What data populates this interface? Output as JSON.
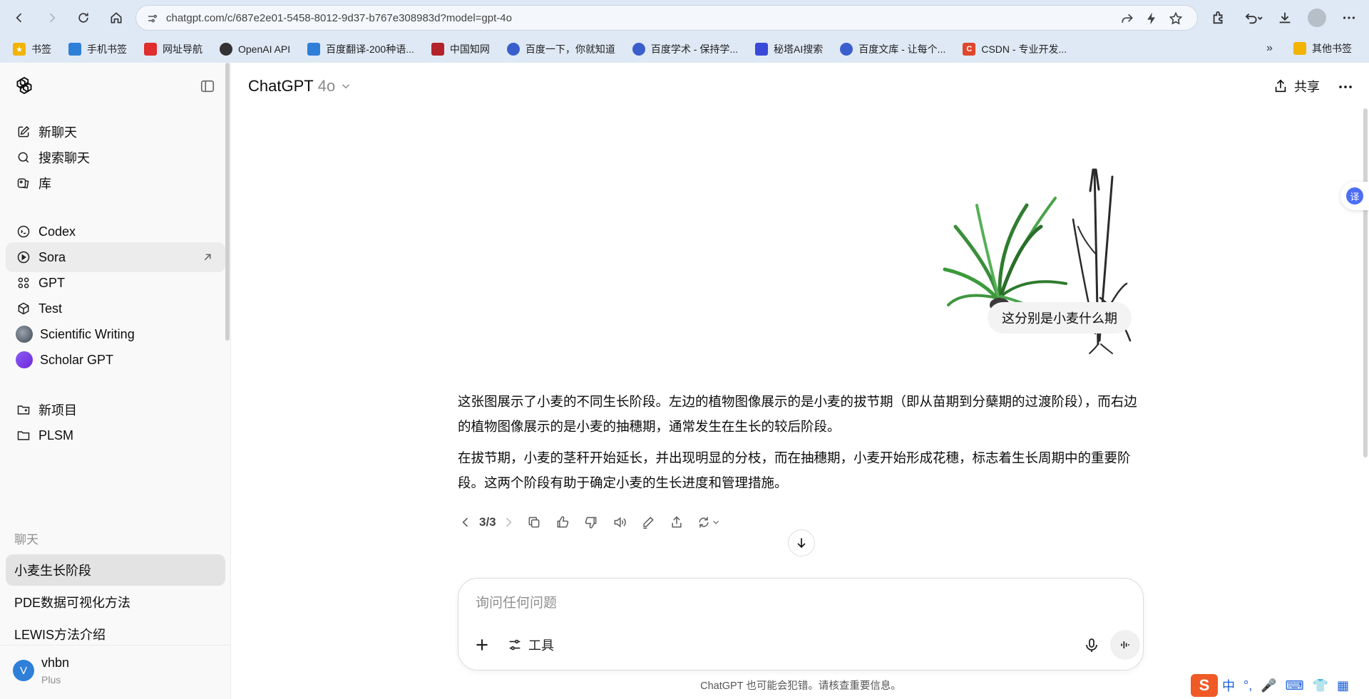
{
  "browser": {
    "url": "chatgpt.com/c/687e2e01-5458-8012-9d37-b767e308983d?model=gpt-4o",
    "bookmarks": [
      {
        "label": "书签",
        "color": "#f2b400"
      },
      {
        "label": "手机书签",
        "color": "#2f7fd9"
      },
      {
        "label": "网址导航",
        "color": "#e02d2d"
      },
      {
        "label": "OpenAI API",
        "color": "#333333"
      },
      {
        "label": "百度翻译-200种语...",
        "color": "#2f7fd9"
      },
      {
        "label": "中国知网",
        "color": "#b4232a"
      },
      {
        "label": "百度一下，你就知道",
        "color": "#3a5fcd"
      },
      {
        "label": "百度学术 - 保持学...",
        "color": "#3a5fcd"
      },
      {
        "label": "秘塔AI搜索",
        "color": "#3a4ad8"
      },
      {
        "label": "百度文库 - 让每个...",
        "color": "#3a5fcd"
      },
      {
        "label": "CSDN - 专业开发...",
        "color": "#e0462b"
      }
    ],
    "bookmarks_more": "»",
    "other_bookmarks": "其他书签"
  },
  "sidebar": {
    "top_items": [
      {
        "label": "新聊天",
        "icon": "new-chat-icon"
      },
      {
        "label": "搜索聊天",
        "icon": "search-icon"
      },
      {
        "label": "库",
        "icon": "library-icon"
      }
    ],
    "app_items": [
      {
        "label": "Codex",
        "icon": "codex-icon"
      },
      {
        "label": "Sora",
        "icon": "sora-icon"
      },
      {
        "label": "GPT",
        "icon": "gpt-grid-icon"
      },
      {
        "label": "Test",
        "icon": "cube-icon"
      },
      {
        "label": "Scientific Writing",
        "icon": "scientific-writing-avatar"
      },
      {
        "label": "Scholar GPT",
        "icon": "scholar-gpt-avatar"
      }
    ],
    "project_items": [
      {
        "label": "新项目",
        "icon": "new-folder-icon"
      },
      {
        "label": "PLSM",
        "icon": "folder-icon"
      }
    ],
    "chats_heading": "聊天",
    "chats": [
      "小麦生长阶段",
      "PDE数据可视化方法",
      "LEWIS方法介绍"
    ],
    "user": {
      "initial": "V",
      "name": "vhbn",
      "plan": "Plus"
    }
  },
  "header": {
    "model_name": "ChatGPT",
    "model_version": "4o",
    "share_label": "共享"
  },
  "conversation": {
    "user_message": "这分别是小麦什么期",
    "assistant_paragraphs": [
      "这张图展示了小麦的不同生长阶段。左边的植物图像展示的是小麦的拔节期（即从苗期到分蘖期的过渡阶段），而右边的植物图像展示的是小麦的抽穗期，通常发生在生长的较后阶段。",
      "在拔节期，小麦的茎秆开始延长，并出现明显的分枝，而在抽穗期，小麦开始形成花穗，标志着生长周期中的重要阶段。这两个阶段有助于确定小麦的生长进度和管理措施。"
    ],
    "pager": "3/3"
  },
  "composer": {
    "placeholder": "询问任何问题",
    "tools_label": "工具"
  },
  "disclaimer": "ChatGPT 也可能会犯错。请核查重要信息。",
  "translate_fab": "译",
  "ime": {
    "logo": "S",
    "lang": "中"
  }
}
